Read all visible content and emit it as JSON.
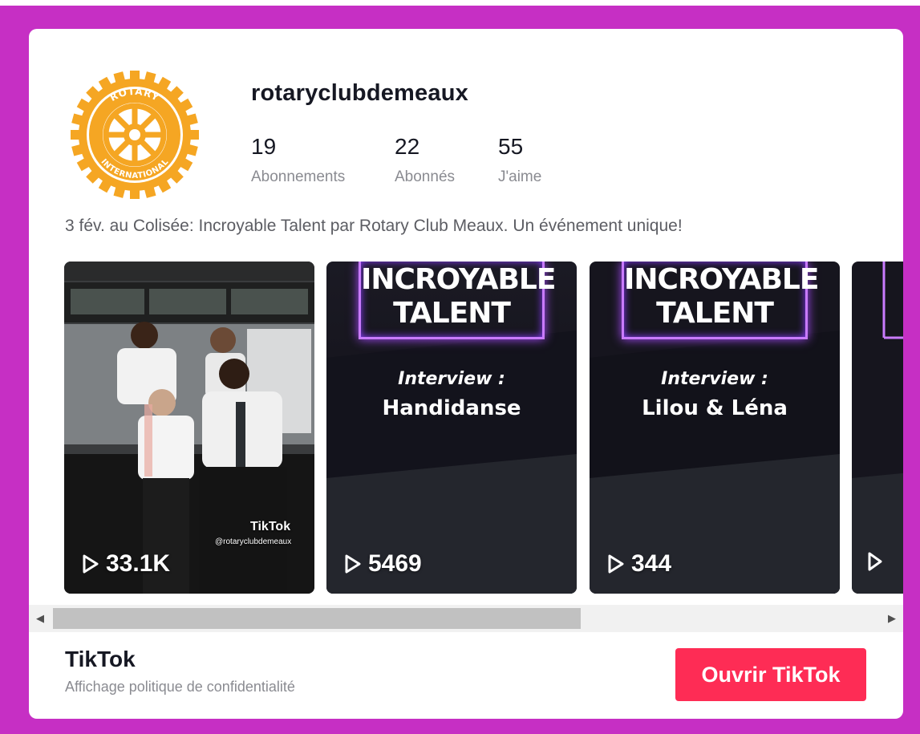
{
  "profile": {
    "username": "rotaryclubdemeaux",
    "logo_text_top": "ROTARY",
    "logo_text_bottom": "INTERNATIONAL",
    "logo_color": "#f5a623",
    "stats": [
      {
        "value": "19",
        "label": "Abonnements"
      },
      {
        "value": "22",
        "label": "Abonnés"
      },
      {
        "value": "55",
        "label": "J'aime"
      }
    ],
    "bio": "3 fév. au Colisée: Incroyable Talent par Rotary Club Meaux. Un événement unique!"
  },
  "videos": [
    {
      "type": "photo",
      "views": "33.1K",
      "watermark": "TikTok",
      "handle": "@rotaryclubdemeaux"
    },
    {
      "type": "interview",
      "title_line1": "INCROYABLE",
      "title_line2": "TALENT",
      "subtitle": "Interview :",
      "name": "Handidanse",
      "views": "5469"
    },
    {
      "type": "interview",
      "title_line1": "INCROYABLE",
      "title_line2": "TALENT",
      "subtitle": "Interview :",
      "name": "Lilou & Léna",
      "views": "344"
    },
    {
      "type": "interview",
      "title_line1": "",
      "title_line2": "",
      "subtitle": "",
      "name": "",
      "views": ""
    }
  ],
  "footer": {
    "brand": "TikTok",
    "privacy_link": "Affichage politique de confidentialité",
    "open_button": "Ouvrir TikTok"
  },
  "colors": {
    "frame": "#c62fc4",
    "button": "#fe2c55",
    "neon": "#c97bff"
  }
}
